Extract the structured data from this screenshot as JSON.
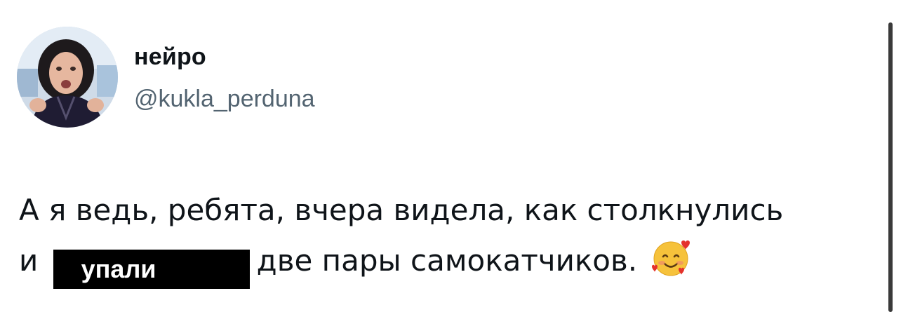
{
  "tweet": {
    "display_name": "нейро",
    "handle": "@kukla_perduna",
    "text_line1": "А я ведь, ребята, вчера видела, как столкнулись",
    "text_line2_start": "и",
    "redacted_word": "упали",
    "text_line2_end": "две пары самокатчиков.",
    "emoji": "smiling-face-with-hearts"
  },
  "colors": {
    "name": "#0f1419",
    "handle": "#536471",
    "redaction": "#000000"
  }
}
